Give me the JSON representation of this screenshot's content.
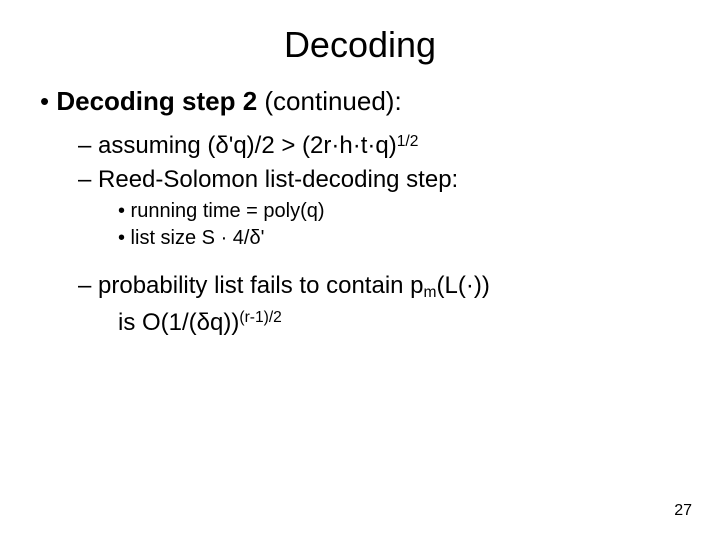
{
  "title": "Decoding",
  "l1": {
    "bullet": "•",
    "head_bold": "Decoding step 2 ",
    "head_rest": "(continued):"
  },
  "a1": {
    "pre": "– assuming (",
    "delta": "δ",
    "mid": "'q)/2 > (2r·h·t·q)",
    "exp": "1/2"
  },
  "a2": "– Reed-Solomon list-decoding step:",
  "b1": "• running time = poly(q)",
  "b2": {
    "pre": "• list size S · 4/",
    "delta": "δ",
    "post": "'"
  },
  "c1": {
    "pre": "– probability list fails to contain p",
    "sub": "m",
    "post": "(L(·))"
  },
  "c2": {
    "pre": "is O(1/(",
    "delta": "δ",
    "mid": "q))",
    "exp": "(r-1)/2"
  },
  "page": "27"
}
